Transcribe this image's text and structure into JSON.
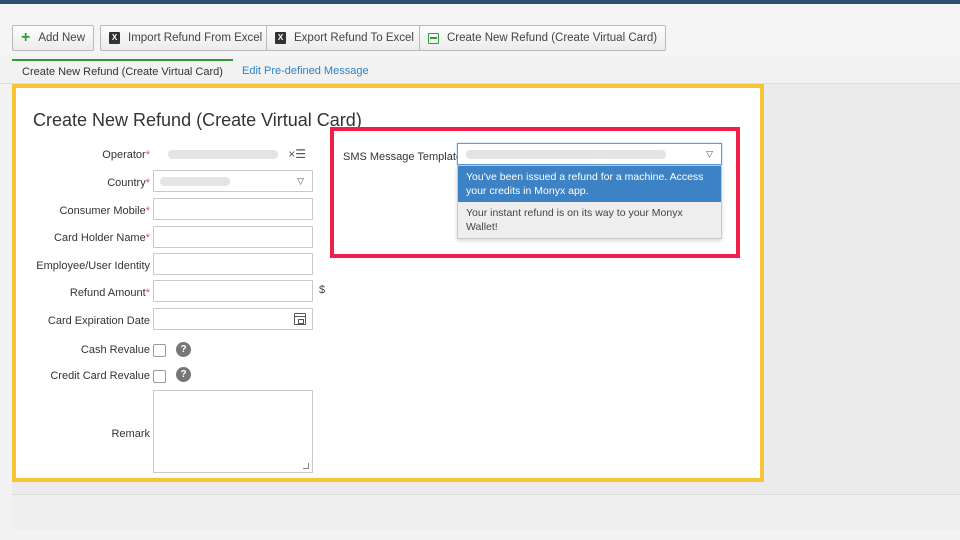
{
  "toolbar": {
    "buttons": [
      {
        "label": "Add New",
        "icon": "plus-icon"
      },
      {
        "label": "Import Refund From Excel",
        "icon": "excel-icon"
      },
      {
        "label": "Export Refund To Excel",
        "icon": "excel-icon"
      },
      {
        "label": "Create New Refund (Create Virtual Card)",
        "icon": "card-icon"
      }
    ]
  },
  "tabs": [
    {
      "label": "Create New Refund (Create Virtual Card)",
      "active": true
    },
    {
      "label": "Edit Pre-defined Message",
      "active": false
    }
  ],
  "form": {
    "title": "Create New Refund (Create Virtual Card)",
    "fields": {
      "operator": {
        "label": "Operator",
        "required_mark": "*"
      },
      "country": {
        "label": "Country",
        "required_mark": "*"
      },
      "consumer_mobile": {
        "label": "Consumer Mobile",
        "required_mark": "*",
        "value": ""
      },
      "card_holder_name": {
        "label": "Card Holder Name",
        "required_mark": "*",
        "value": ""
      },
      "employee_identity": {
        "label": "Employee/User Identity",
        "value": ""
      },
      "refund_amount": {
        "label": "Refund Amount",
        "required_mark": "*",
        "value": "",
        "unit": "$"
      },
      "card_expiration": {
        "label": "Card Expiration Date",
        "value": ""
      },
      "cash_revalue": {
        "label": "Cash Revalue",
        "checked": false
      },
      "credit_card_revalue": {
        "label": "Credit Card Revalue",
        "checked": false
      },
      "remark": {
        "label": "Remark",
        "value": ""
      }
    },
    "help_glyph": "?",
    "clear_glyph": "×☰",
    "caret_glyph": "▽"
  },
  "sms": {
    "label": "SMS Message Template",
    "options": [
      {
        "text": "You've been issued a refund for a machine. Access your credits in Monyx app.",
        "highlighted": true
      },
      {
        "text": "Your instant refund is on its way to your Monyx Wallet!",
        "highlighted": false
      }
    ]
  },
  "colors": {
    "panel_outline": "#f5c536",
    "highlight_outline": "#ef1f4a",
    "accent_green": "#2e9d36",
    "link_blue": "#2f82c4",
    "selected_option": "#3d82c4"
  }
}
